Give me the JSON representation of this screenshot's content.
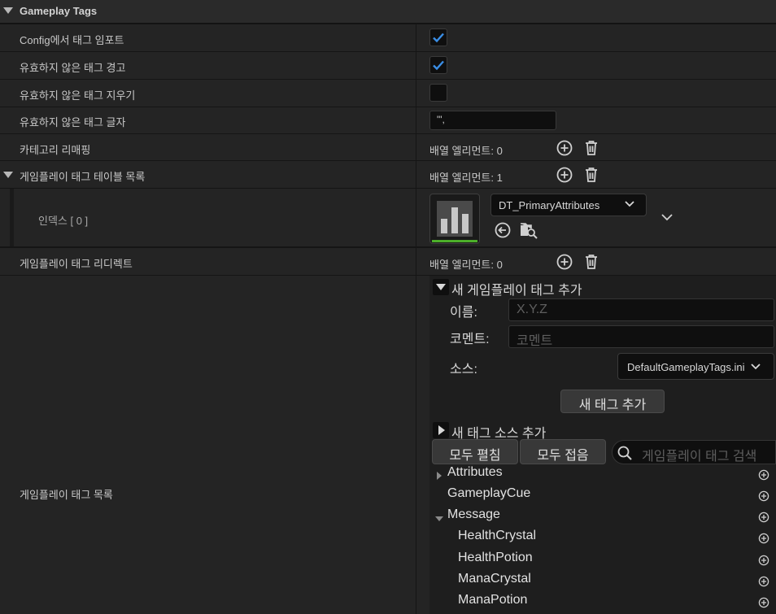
{
  "section": {
    "title": "Gameplay Tags"
  },
  "rows": {
    "import_config": {
      "label": "Config에서 태그 임포트",
      "checked": true
    },
    "warn_invalid": {
      "label": "유효하지 않은 태그 경고",
      "checked": true
    },
    "clear_invalid": {
      "label": "유효하지 않은 태그 지우기",
      "checked": false
    },
    "invalid_chars": {
      "label": "유효하지 않은 태그 글자",
      "value": "\"',",
      "value_display": "\"',"
    },
    "category_remap": {
      "label": "카테고리 리매핑",
      "array": "배열 엘리먼트: 0"
    },
    "table_list": {
      "label": "게임플레이 태그 테이블 목록",
      "array": "배열 엘리먼트: 1"
    },
    "index0": {
      "label": "인덱스 [ 0 ]",
      "asset": "DT_PrimaryAttributes"
    },
    "redirects": {
      "label": "게임플레이 태그 리디렉트",
      "array": "배열 엘리먼트: 0"
    },
    "tag_list": {
      "label": "게임플레이 태그 목록"
    }
  },
  "add_tag": {
    "header": "새 게임플레이 태그 추가",
    "name_label": "이름:",
    "name_placeholder": "X.Y.Z",
    "comment_label": "코멘트:",
    "comment_placeholder": "코멘트",
    "source_label": "소스:",
    "source_value": "DefaultGameplayTags.ini",
    "add_button": "새 태그 추가"
  },
  "add_source": {
    "header": "새 태그 소스 추가"
  },
  "toolbar": {
    "expand_all": "모두 펼침",
    "collapse_all": "모두 접음",
    "search_placeholder": "게임플레이 태그 검색"
  },
  "tags": [
    {
      "name": "Attributes",
      "expander": "collapsed"
    },
    {
      "name": "GameplayCue",
      "expander": "none"
    },
    {
      "name": "Message",
      "expander": "expanded"
    },
    {
      "name": "HealthCrystal",
      "expander": "child"
    },
    {
      "name": "HealthPotion",
      "expander": "child"
    },
    {
      "name": "ManaCrystal",
      "expander": "child"
    },
    {
      "name": "ManaPotion",
      "expander": "child"
    }
  ],
  "colors": {
    "accent": "#3a8ee6",
    "green_bar": "#4caf2a",
    "panel_bg": "#242424"
  }
}
